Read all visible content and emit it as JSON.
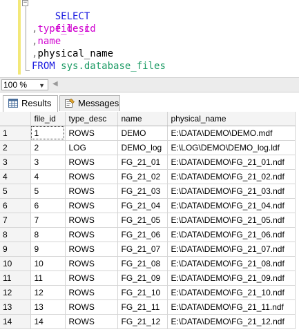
{
  "editor": {
    "lines": [
      {
        "kind": "keyword",
        "text": "SELECT"
      },
      {
        "kind": "column",
        "text": "file_id"
      },
      {
        "kind": "column_comma",
        "prefix": ",",
        "text": "type_desc"
      },
      {
        "kind": "column_comma",
        "prefix": ",",
        "text": "name"
      },
      {
        "kind": "column_comma",
        "prefix": ",",
        "text": "physical_name"
      },
      {
        "kind": "from",
        "keyword": "FROM",
        "object": "sys.database_files"
      }
    ],
    "colors": {
      "keyword": "#1d1de0",
      "identifier": "#d000d0",
      "object": "#1a9a63",
      "operator": "#7a7a7a"
    }
  },
  "zoom": {
    "value": "100 %"
  },
  "tabs": {
    "results": "Results",
    "messages": "Messages"
  },
  "grid": {
    "columns": [
      "file_id",
      "type_desc",
      "name",
      "physical_name"
    ],
    "rows": [
      [
        "1",
        "1",
        "ROWS",
        "DEMO",
        "E:\\DATA\\DEMO\\DEMO.mdf"
      ],
      [
        "2",
        "2",
        "LOG",
        "DEMO_log",
        "E:\\LOG\\DEMO\\DEMO_log.ldf"
      ],
      [
        "3",
        "3",
        "ROWS",
        "FG_21_01",
        "E:\\DATA\\DEMO\\FG_21_01.ndf"
      ],
      [
        "4",
        "4",
        "ROWS",
        "FG_21_02",
        "E:\\DATA\\DEMO\\FG_21_02.ndf"
      ],
      [
        "5",
        "5",
        "ROWS",
        "FG_21_03",
        "E:\\DATA\\DEMO\\FG_21_03.ndf"
      ],
      [
        "6",
        "6",
        "ROWS",
        "FG_21_04",
        "E:\\DATA\\DEMO\\FG_21_04.ndf"
      ],
      [
        "7",
        "7",
        "ROWS",
        "FG_21_05",
        "E:\\DATA\\DEMO\\FG_21_05.ndf"
      ],
      [
        "8",
        "8",
        "ROWS",
        "FG_21_06",
        "E:\\DATA\\DEMO\\FG_21_06.ndf"
      ],
      [
        "9",
        "9",
        "ROWS",
        "FG_21_07",
        "E:\\DATA\\DEMO\\FG_21_07.ndf"
      ],
      [
        "10",
        "10",
        "ROWS",
        "FG_21_08",
        "E:\\DATA\\DEMO\\FG_21_08.ndf"
      ],
      [
        "11",
        "11",
        "ROWS",
        "FG_21_09",
        "E:\\DATA\\DEMO\\FG_21_09.ndf"
      ],
      [
        "12",
        "12",
        "ROWS",
        "FG_21_10",
        "E:\\DATA\\DEMO\\FG_21_10.ndf"
      ],
      [
        "13",
        "13",
        "ROWS",
        "FG_21_11",
        "E:\\DATA\\DEMO\\FG_21_11.ndf"
      ],
      [
        "14",
        "14",
        "ROWS",
        "FG_21_12",
        "E:\\DATA\\DEMO\\FG_21_12.ndf"
      ]
    ]
  }
}
